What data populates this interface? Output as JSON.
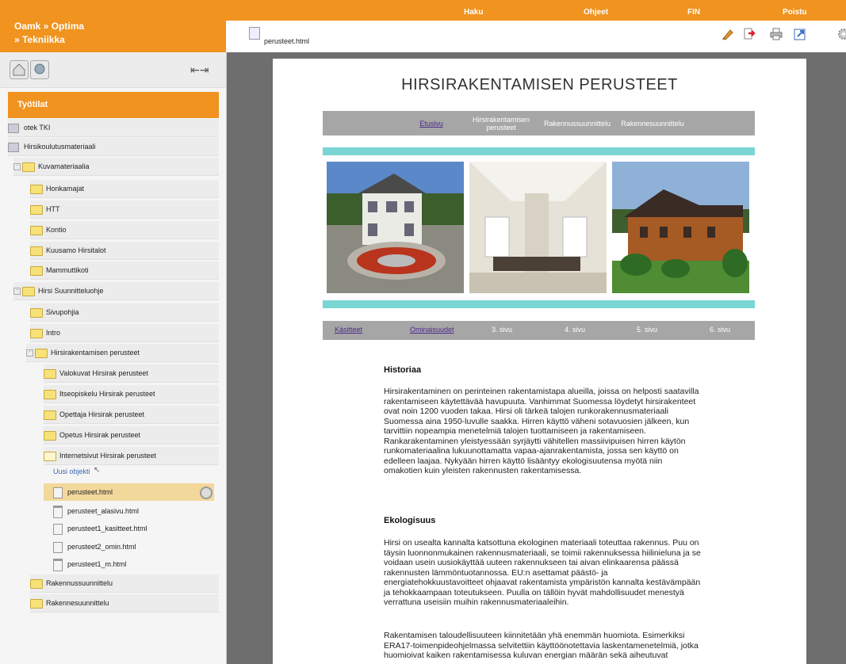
{
  "app": {
    "breadcrumb_line1": "Oamk » Optima",
    "breadcrumb_line2": "» Tekniikka",
    "accent": "#f0931f"
  },
  "topnav": {
    "search": "Haku",
    "guides": "Ohjeet",
    "lang": "FIN",
    "logout": "Poistu"
  },
  "tab": {
    "label": "perusteet.html"
  },
  "toolbar": {
    "icons": [
      "edit-icon",
      "export-icon",
      "print-icon",
      "open-new-window-icon",
      "settings-icon"
    ]
  },
  "sidebar": {
    "workspace_label": "Työtilat",
    "new_object": "Uusi objekti",
    "items": [
      {
        "label": "otek TKI"
      },
      {
        "label": "Hirsikoulutusmateriaali"
      },
      {
        "label": "Kuvamateriaalia"
      },
      {
        "label": "Honkamajat"
      },
      {
        "label": "HTT"
      },
      {
        "label": "Kontio"
      },
      {
        "label": "Kuusamo Hirsitalot"
      },
      {
        "label": "Mammuttikoti"
      },
      {
        "label": "Hirsi Suunnitteluohje"
      },
      {
        "label": "Sivupohjia"
      },
      {
        "label": "Intro"
      },
      {
        "label": "Hirsirakentamisen perusteet"
      },
      {
        "label": "Valokuvat Hirsirak perusteet"
      },
      {
        "label": "Itseopiskelu Hirsirak perusteet"
      },
      {
        "label": "Opettaja Hirsirak perusteet"
      },
      {
        "label": "Opetus Hirsirak perusteet"
      },
      {
        "label": "Internetsivut Hirsirak perusteet"
      },
      {
        "label": "perusteet.html"
      },
      {
        "label": "perusteet_alasivu.html"
      },
      {
        "label": "perusteet1_kasitteet.html"
      },
      {
        "label": "perusteet2_omin.html"
      },
      {
        "label": "perusteet1_m.html"
      },
      {
        "label": "Rakennussuunnittelu"
      },
      {
        "label": "Rakennesuunnittelu"
      }
    ]
  },
  "document": {
    "title": "HIRSIRAKENTAMISEN PERUSTEET",
    "nav": [
      "Etusivu",
      "Hirsirakentamisen perusteet",
      "Rakennussuunnittelu",
      "Rakennesuunnittelu"
    ],
    "subnav": [
      "Käsitteet",
      "Ominaisuudet",
      "3. sivu",
      "4. sivu",
      "5. sivu",
      "6. sivu"
    ],
    "section1_title": "Historiaa",
    "section1_text": "Hirsirakentaminen on perinteinen rakentamistapa alueilla, joissa on helposti saatavilla rakentamiseen käytettävää havupuuta. Vanhimmat Suomessa löydetyt hirsirakenteet ovat noin 1200 vuoden takaa. Hirsi oli tärkeä talojen runkorakennusmateriaali Suomessa aina 1950-luvulle saakka. Hirren käyttö väheni sotavuosien jälkeen, kun tarvittiin nopeampia menetelmiä talojen tuottamiseen ja rakentamiseen. Rankarakentaminen yleistyessään syrjäytti vähitellen massiivipuisen hirren käytön runkomateriaalina lukuunottamatta vapaa-ajanrakentamista, jossa sen käyttö on edelleen laajaa. Nykyään hirren käyttö lisääntyy ekologisuutensa myötä niin omakotien kuin yleisten rakennusten rakentamisessa.",
    "section2_title": "Ekologisuus",
    "section2_text": "Hirsi on usealta kannalta katsottuna ekologinen materiaali toteuttaa rakennus. Puu on täysin luonnonmukainen rakennusmateriaali, se toimii rakennuksessa hiilinieluna ja se voidaan usein uusiokäyttää uuteen rakennukseen tai aivan elinkaarensa päässä rakennusten lämmöntuotannossa. EU:n asettamat päästö- ja energiatehokkuustavoitteet ohjaavat rakentamista ympäristön kannalta kestävämpään ja tehokkaampaan toteutukseen. Puulla on tällöin hyvät mahdollisuudet menestyä verrattuna useisiin muihin rakennusmateriaaleihin.",
    "section3_text": "Rakentamisen taloudellisuuteen kiinnitetään yhä enemmän huomiota.  Esimerkiksi ERA17-toimenpideohjelmassa selvitettiin käyttöönotettavia laskentamenetelmiä, jotka huomioivat kaiken rakentamisessa kuluvan energian määrän sekä aiheutuvat"
  }
}
